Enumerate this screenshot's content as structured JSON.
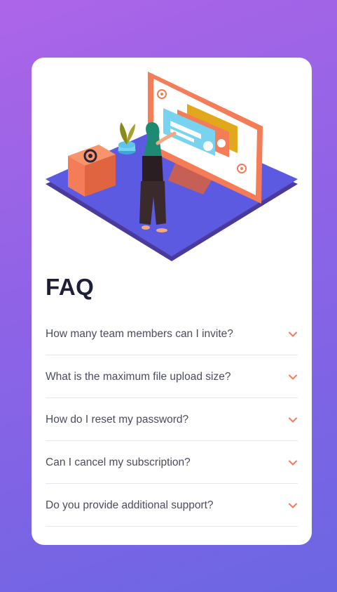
{
  "colors": {
    "background_top": "#ad65e8",
    "background_bottom": "#6b66e3",
    "card": "#ffffff",
    "title": "#1e1f36",
    "question_text": "#4b4c5f",
    "accent": "#f47c57",
    "divider": "#e6e6ef"
  },
  "hero": {
    "icon": "woman-at-monitor-illustration"
  },
  "faq": {
    "title": "FAQ",
    "items": [
      {
        "question": "How many team members can I invite?",
        "icon": "chevron-down-icon"
      },
      {
        "question": "What is the maximum file upload size?",
        "icon": "chevron-down-icon"
      },
      {
        "question": "How do I reset my password?",
        "icon": "chevron-down-icon"
      },
      {
        "question": "Can I cancel my subscription?",
        "icon": "chevron-down-icon"
      },
      {
        "question": "Do you provide additional support?",
        "icon": "chevron-down-icon"
      }
    ]
  }
}
